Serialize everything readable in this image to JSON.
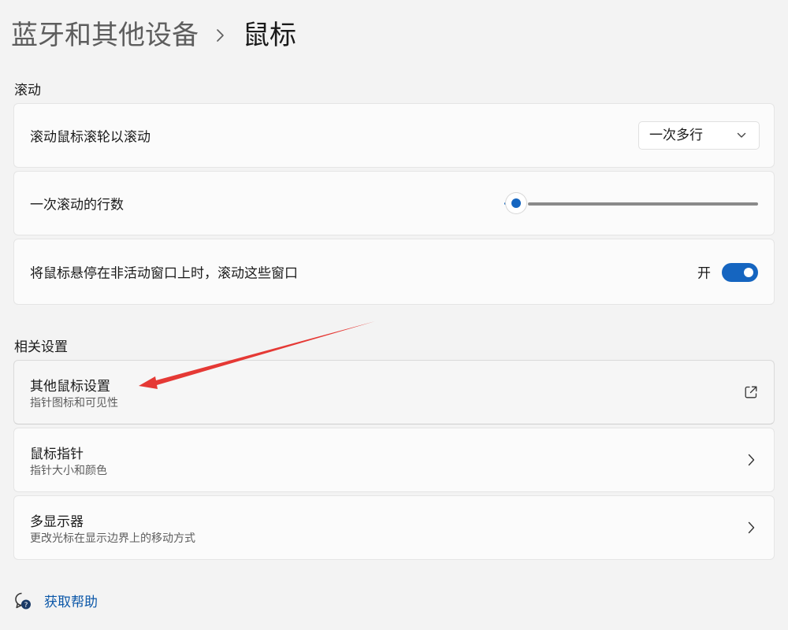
{
  "breadcrumb": {
    "parent": "蓝牙和其他设备",
    "current": "鼠标"
  },
  "scroll_section": {
    "title": "滚动",
    "wheel_row": {
      "label": "滚动鼠标滚轮以滚动",
      "dropdown_value": "一次多行"
    },
    "lines_row": {
      "label": "一次滚动的行数",
      "slider_fraction": 0.0
    },
    "inactive_row": {
      "label": "将鼠标悬停在非活动窗口上时，滚动这些窗口",
      "toggle_state": "开",
      "toggle_on": true
    }
  },
  "related_section": {
    "title": "相关设置",
    "items": [
      {
        "title": "其他鼠标设置",
        "subtitle": "指针图标和可见性",
        "icon": "open-external-icon"
      },
      {
        "title": "鼠标指针",
        "subtitle": "指针大小和颜色",
        "icon": "chevron-right-icon"
      },
      {
        "title": "多显示器",
        "subtitle": "更改光标在显示边界上的移动方式",
        "icon": "chevron-right-icon"
      }
    ]
  },
  "help": {
    "label": "获取帮助"
  },
  "colors": {
    "accent": "#1565c0",
    "annotation_arrow": "#e53935",
    "background": "#f3f3f3",
    "card": "#fbfbfb"
  }
}
